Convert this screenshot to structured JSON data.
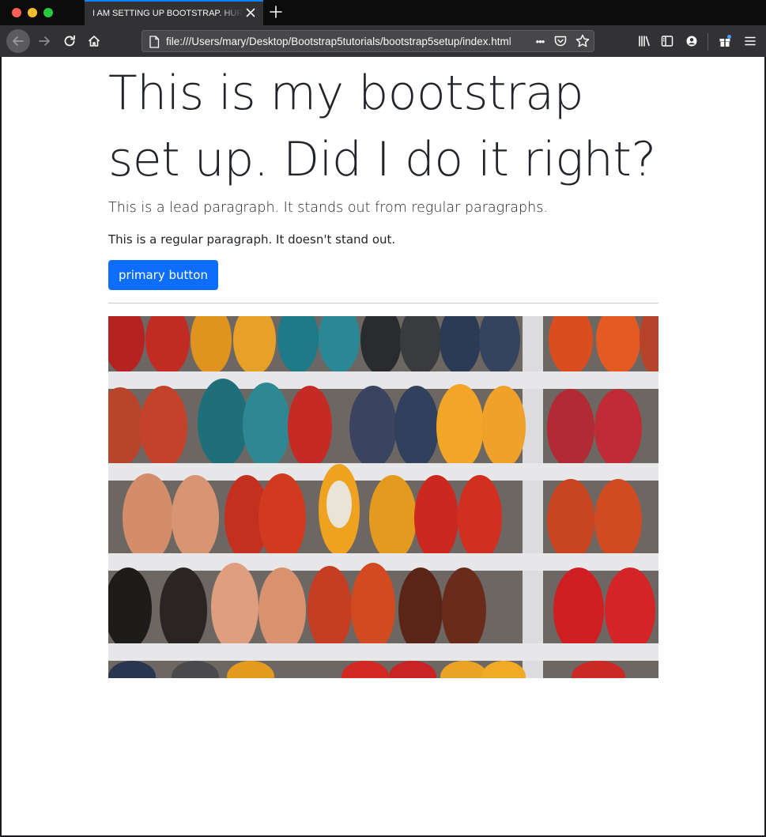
{
  "browser": {
    "tab_title": "I AM SETTING UP BOOTSTRAP. HURRAY!",
    "url": "file:///Users/mary/Desktop/Bootstrap5tutorials/bootstrap5setup/index.html",
    "more_glyph": "•••"
  },
  "page": {
    "heading": "This is my bootstrap set up. Did I do it right?",
    "lead": "This is a lead paragraph. It stands out from regular paragraphs.",
    "paragraph": "This is a regular paragraph. It doesn't stand out.",
    "button_label": "primary button",
    "image_alt": "Rows of colorful leather slippers on white wooden shelves"
  },
  "colors": {
    "primary": "#0d6efd",
    "tab_accent": "#0a84ff",
    "text": "#212529"
  }
}
